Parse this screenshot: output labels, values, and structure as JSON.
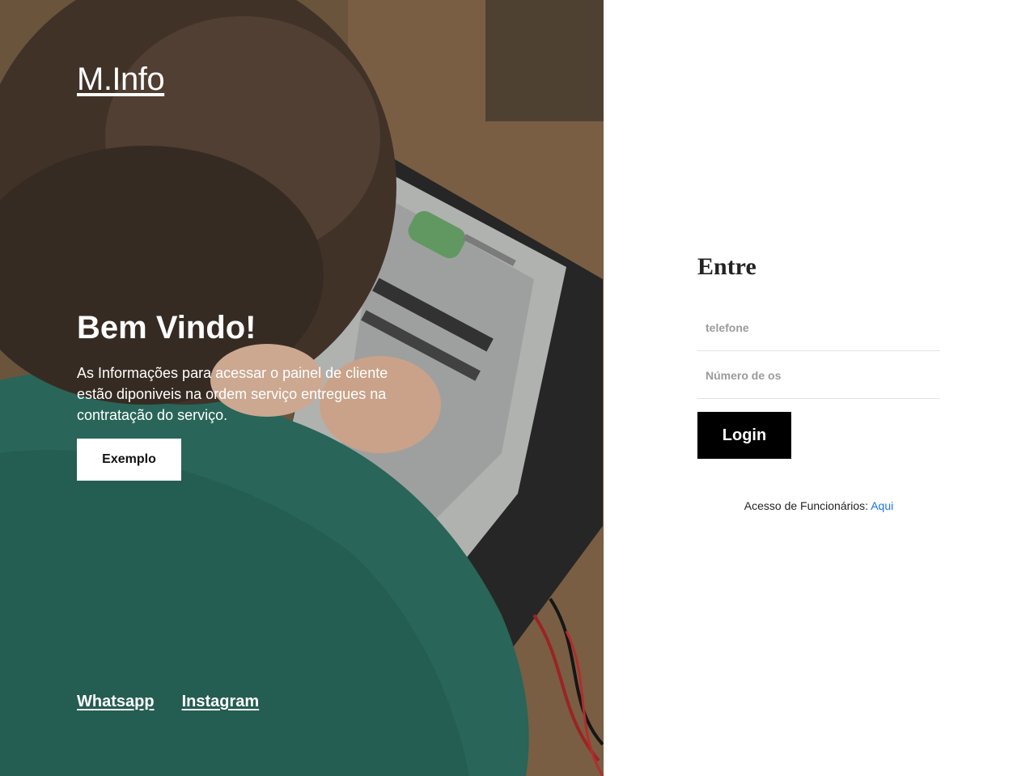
{
  "hero": {
    "brand": "M.Info",
    "title": "Bem Vindo!",
    "description": "As Informações para acessar o painel de cliente estão diponiveis na ordem serviço entregues na contratação do serviço.",
    "example_label": "Exemplo",
    "social": {
      "whatsapp": "Whatsapp",
      "instagram": "Instagram"
    }
  },
  "login": {
    "title": "Entre",
    "phone_placeholder": "telefone",
    "os_placeholder": "Número de os",
    "button_label": "Login",
    "staff_text": "Acesso de Funcionários:",
    "staff_link": "Aqui"
  },
  "colors": {
    "accent_link": "#1a73e8",
    "button_dark": "#000000"
  }
}
